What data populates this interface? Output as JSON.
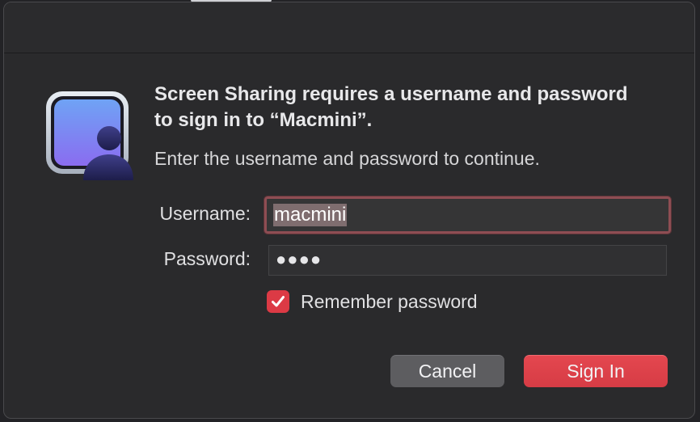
{
  "dialog": {
    "headline": "Screen Sharing requires a username and password to sign in to “Macmini”.",
    "subtext": "Enter the username and password to continue.",
    "icon": "screen-sharing-icon"
  },
  "form": {
    "username_label": "Username:",
    "username_value": "macmini",
    "password_label": "Password:",
    "password_mask": "●●●●",
    "remember_label": "Remember password",
    "remember_checked": true
  },
  "buttons": {
    "cancel_label": "Cancel",
    "signin_label": "Sign In"
  },
  "colors": {
    "accent": "#dc3a45",
    "dialog_bg": "#2a2a2c",
    "focus_ring": "#8e4d53"
  }
}
